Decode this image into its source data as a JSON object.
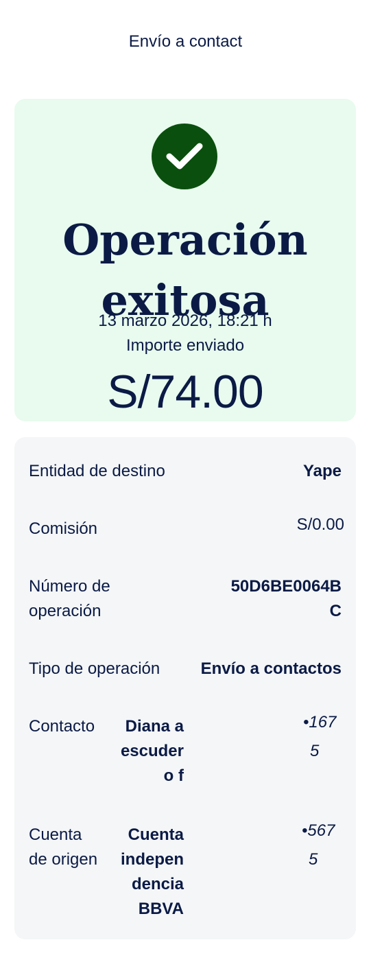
{
  "header": {
    "title": "Envío a contact"
  },
  "success": {
    "title": "Operación exitosa",
    "date": "13 marzo 2026, 18:21 h",
    "amount_label": "Importe enviado",
    "amount": "S/74.00",
    "accent_color": "#0b4f0e",
    "background_color": "#e8fbee",
    "icon": "check-icon"
  },
  "details": {
    "entidad": {
      "label": "Entidad de destino",
      "value": "Yape"
    },
    "comision": {
      "label": "Comisión",
      "value": "S/0.00"
    },
    "numero": {
      "label_1": "Número de",
      "label_2": "operación",
      "value_1": "50D6BE0064B",
      "value_2": "C"
    },
    "tipo": {
      "label": "Tipo de operación",
      "value": "Envío a contactos"
    },
    "contacto": {
      "label": "Contacto",
      "name_1": "Diana a",
      "name_2": "escuder",
      "name_3": "o f",
      "mask_1": "•167",
      "mask_2": "5"
    },
    "cuenta": {
      "label_1": "Cuenta",
      "label_2": "de origen",
      "name_1": "Cuenta",
      "name_2": "indepen",
      "name_3": "dencia",
      "name_4": "BBVA",
      "mask_1": "•567",
      "mask_2": "5"
    }
  }
}
